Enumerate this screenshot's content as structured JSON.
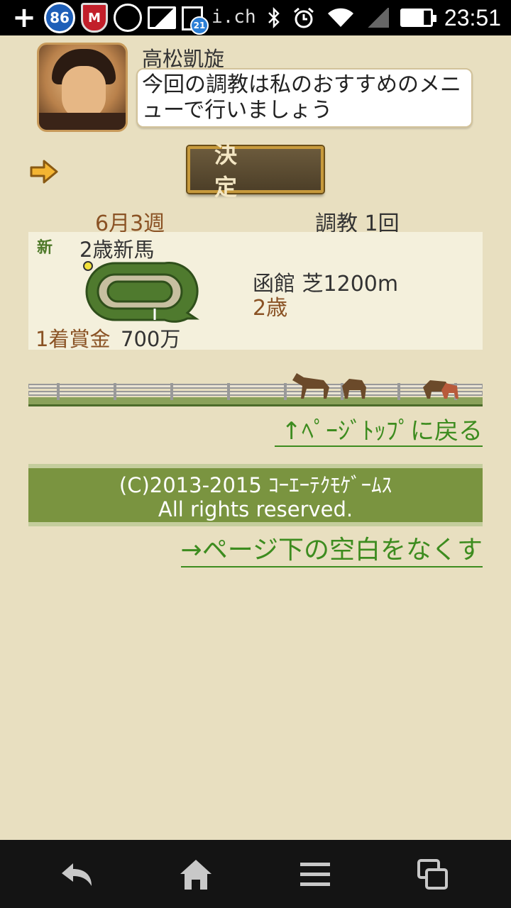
{
  "status_bar": {
    "badge_count": "86",
    "mcafee_letter": "M",
    "ich_count": "21",
    "ich_label": "i.ch",
    "time": "23:51",
    "icons": [
      "add-icon",
      "notification-count-icon",
      "mcafee-icon",
      "launcher-icon",
      "gallery-icon",
      "ich-app-icon",
      "bluetooth-icon",
      "alarm-icon",
      "wifi-icon",
      "signal-icon",
      "battery-charging-icon"
    ]
  },
  "advisor": {
    "name": "高松凱旋",
    "message": "今回の調教は私のおすすめのメニューで行いましょう"
  },
  "decide_button": {
    "label": "決 定"
  },
  "schedule": {
    "week": "6月3週",
    "training": "調教 1回"
  },
  "race": {
    "new_mark": "新",
    "name": "2歳新馬",
    "course": "函館 芝1200m",
    "age": "2歳",
    "prize_label": "1着賞金",
    "prize_value": "700万"
  },
  "links": {
    "page_top": "↑ﾍﾟｰｼﾞﾄｯﾌﾟに戻る",
    "remove_blank": "→ページ下の空白をなくす"
  },
  "footer": {
    "copyright": "(C)2013-2015 ｺｰｴｰﾃｸﾓｹﾞｰﾑｽ",
    "rights": "All rights reserved."
  },
  "nav_bar": {
    "icons": [
      "back-icon",
      "home-icon",
      "menu-icon",
      "recent-apps-icon"
    ]
  },
  "colors": {
    "background": "#e8dfc0",
    "accent_brown": "#8a5224",
    "link_green": "#3d8c1f",
    "footer_green": "#7a9440"
  }
}
